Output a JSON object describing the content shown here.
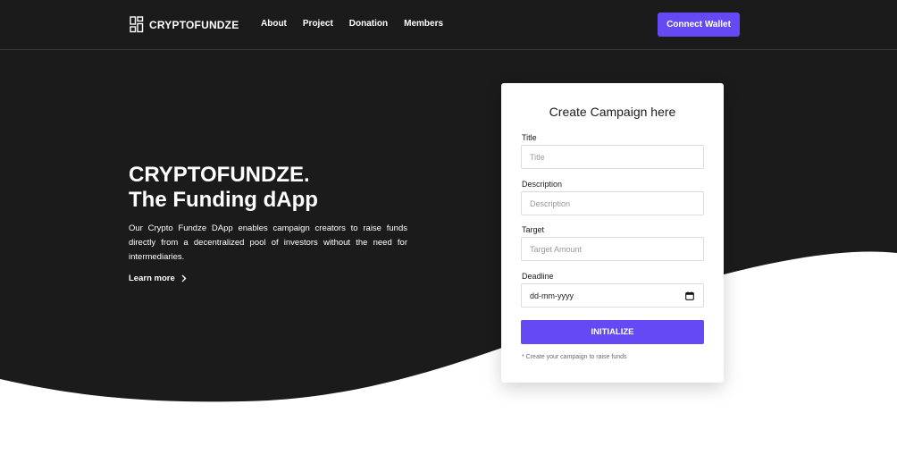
{
  "brand": {
    "name": "CRYPTOFUNDZE",
    "icon": "grid-logo-icon"
  },
  "nav": {
    "links": [
      {
        "label": "About"
      },
      {
        "label": "Project"
      },
      {
        "label": "Donation"
      },
      {
        "label": "Members"
      }
    ],
    "connect_label": "Connect Wallet"
  },
  "hero": {
    "title_line1": "CRYPTOFUNDZE.",
    "title_line2": "The Funding dApp",
    "description": "Our Crypto Fundze DApp enables campaign creators to raise funds directly from a decentralized pool of investors without the need for intermediaries.",
    "learn_more": "Learn more",
    "learn_more_icon": "chevron-right-icon"
  },
  "form": {
    "heading": "Create Campaign here",
    "title": {
      "label": "Title",
      "placeholder": "Title",
      "value": ""
    },
    "description": {
      "label": "Description",
      "placeholder": "Description",
      "value": ""
    },
    "target": {
      "label": "Target",
      "placeholder": "Target Amount",
      "value": ""
    },
    "deadline": {
      "label": "Deadline",
      "value": "dd-mm-yyyy",
      "icon": "calendar-icon"
    },
    "submit_label": "INITIALIZE",
    "note": "* Create your campaign to raise funds"
  },
  "colors": {
    "background_dark": "#1b1b1b",
    "accent": "#6549f5",
    "card": "#ffffff"
  }
}
